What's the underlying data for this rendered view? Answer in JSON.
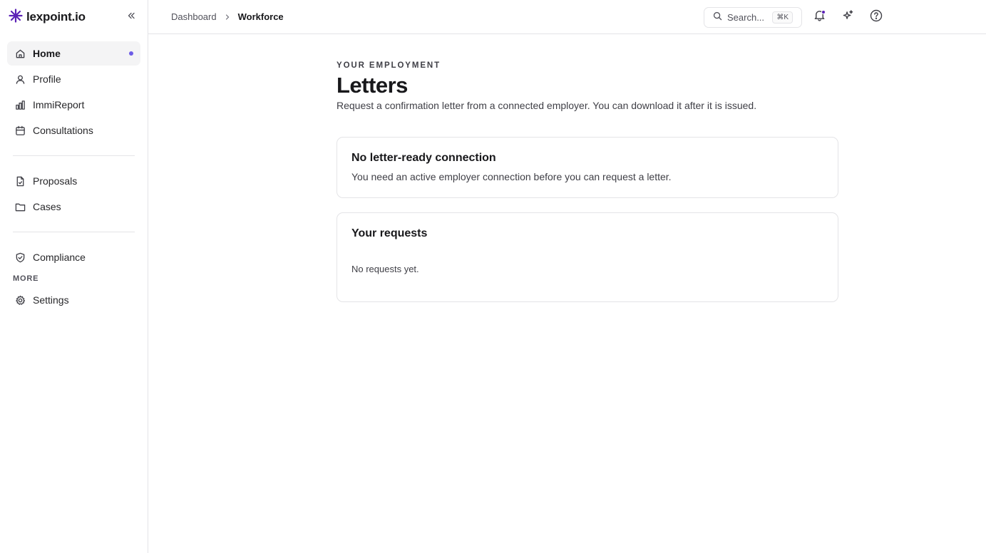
{
  "brand": {
    "name": "lexpoint.io",
    "color": "#5b21b6"
  },
  "sidebar": {
    "primary": [
      {
        "label": "Home",
        "icon": "home-icon",
        "active": true,
        "dot": true
      },
      {
        "label": "Profile",
        "icon": "user-icon"
      },
      {
        "label": "ImmiReport",
        "icon": "bar-chart-icon"
      },
      {
        "label": "Consultations",
        "icon": "calendar-icon"
      }
    ],
    "secondary": [
      {
        "label": "Proposals",
        "icon": "file-icon"
      },
      {
        "label": "Cases",
        "icon": "folder-icon"
      }
    ],
    "tertiary": [
      {
        "label": "Compliance",
        "icon": "shield-check-icon"
      }
    ],
    "more_heading": "MORE",
    "more": [
      {
        "label": "Settings",
        "icon": "gear-icon"
      }
    ],
    "accent": "#6d5ce7"
  },
  "breadcrumb": [
    "Dashboard",
    "Workforce"
  ],
  "search": {
    "placeholder": "Search...",
    "shortcut": "⌘K"
  },
  "page": {
    "eyebrow": "YOUR EMPLOYMENT",
    "title": "Letters",
    "subtitle": "Request a confirmation letter from a connected employer. You can download it after it is issued."
  },
  "cards": {
    "connection": {
      "title": "No letter-ready connection",
      "text": "You need an active employer connection before you can request a letter."
    },
    "requests": {
      "title": "Your requests",
      "text": "No requests yet."
    }
  }
}
